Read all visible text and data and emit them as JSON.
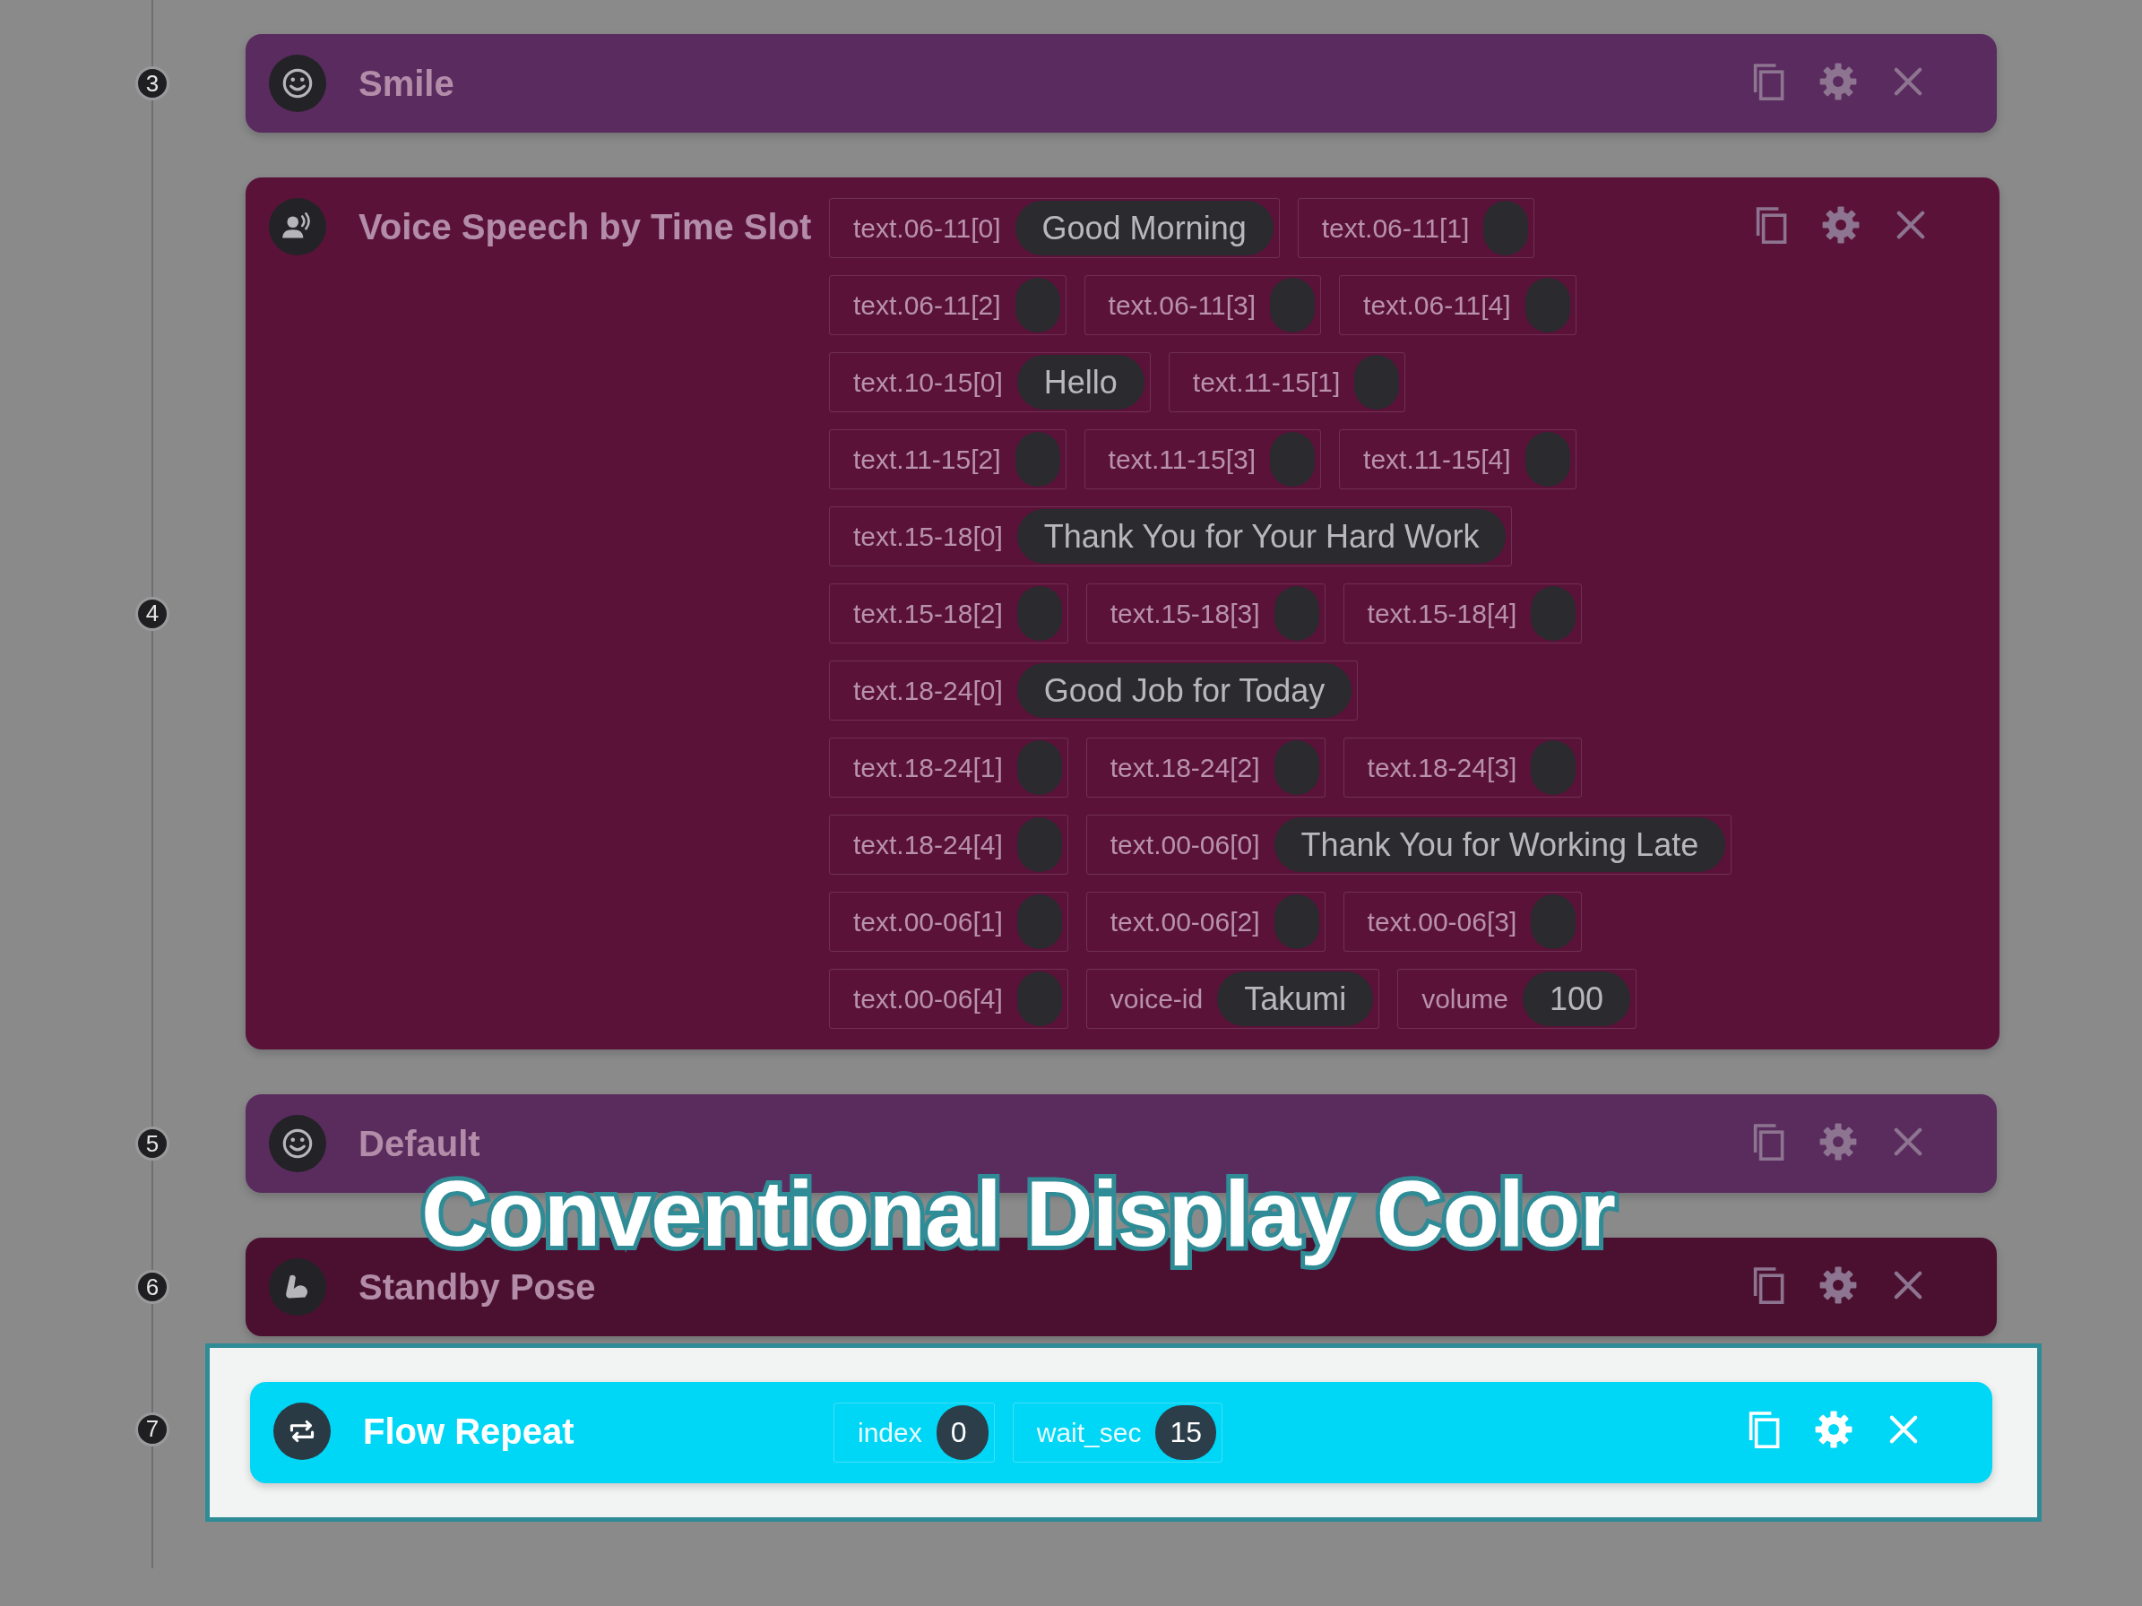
{
  "steps": [
    {
      "number": "3",
      "title": "Smile",
      "kind": "emotion",
      "color": "#5a2b5e",
      "highlighted": false
    },
    {
      "number": "4",
      "title": "Voice Speech by Time Slot",
      "kind": "speech",
      "color": "#5b1239",
      "highlighted": false,
      "param_rows": [
        [
          {
            "label": "text.06-11[0]",
            "value": "Good Morning"
          },
          {
            "label": "text.06-11[1]"
          }
        ],
        [
          {
            "label": "text.06-11[2]"
          },
          {
            "label": "text.06-11[3]"
          },
          {
            "label": "text.06-11[4]"
          }
        ],
        [
          {
            "label": "text.10-15[0]",
            "value": "Hello"
          },
          {
            "label": "text.11-15[1]"
          }
        ],
        [
          {
            "label": "text.11-15[2]"
          },
          {
            "label": "text.11-15[3]"
          },
          {
            "label": "text.11-15[4]"
          }
        ],
        [
          {
            "label": "text.15-18[0]",
            "value": "Thank You for Your Hard Work"
          }
        ],
        [
          {
            "label": "text.15-18[2]"
          },
          {
            "label": "text.15-18[3]"
          },
          {
            "label": "text.15-18[4]"
          }
        ],
        [
          {
            "label": "text.18-24[0]",
            "value": "Good Job for Today"
          }
        ],
        [
          {
            "label": "text.18-24[1]"
          },
          {
            "label": "text.18-24[2]"
          },
          {
            "label": "text.18-24[3]"
          }
        ],
        [
          {
            "label": "text.18-24[4]"
          },
          {
            "label": "text.00-06[0]",
            "value": "Thank You for Working Late"
          }
        ],
        [
          {
            "label": "text.00-06[1]"
          },
          {
            "label": "text.00-06[2]"
          },
          {
            "label": "text.00-06[3]"
          }
        ],
        [
          {
            "label": "text.00-06[4]"
          },
          {
            "label": "voice-id",
            "value": "Takumi"
          },
          {
            "label": "volume",
            "value": "100"
          }
        ]
      ]
    },
    {
      "number": "5",
      "title": "Default",
      "kind": "emotion",
      "color": "#5a2c5e",
      "highlighted": false
    },
    {
      "number": "6",
      "title": "Standby Pose",
      "kind": "pose",
      "color": "#4b1030",
      "highlighted": false
    },
    {
      "number": "7",
      "title": "Flow Repeat",
      "kind": "flow",
      "color": "#00d6f6",
      "highlighted": true,
      "param_rows": [
        [
          {
            "label": "index",
            "value": "0"
          },
          {
            "label": "wait_sec",
            "value": "15"
          }
        ]
      ]
    }
  ],
  "caption": "Conventional Display Color"
}
